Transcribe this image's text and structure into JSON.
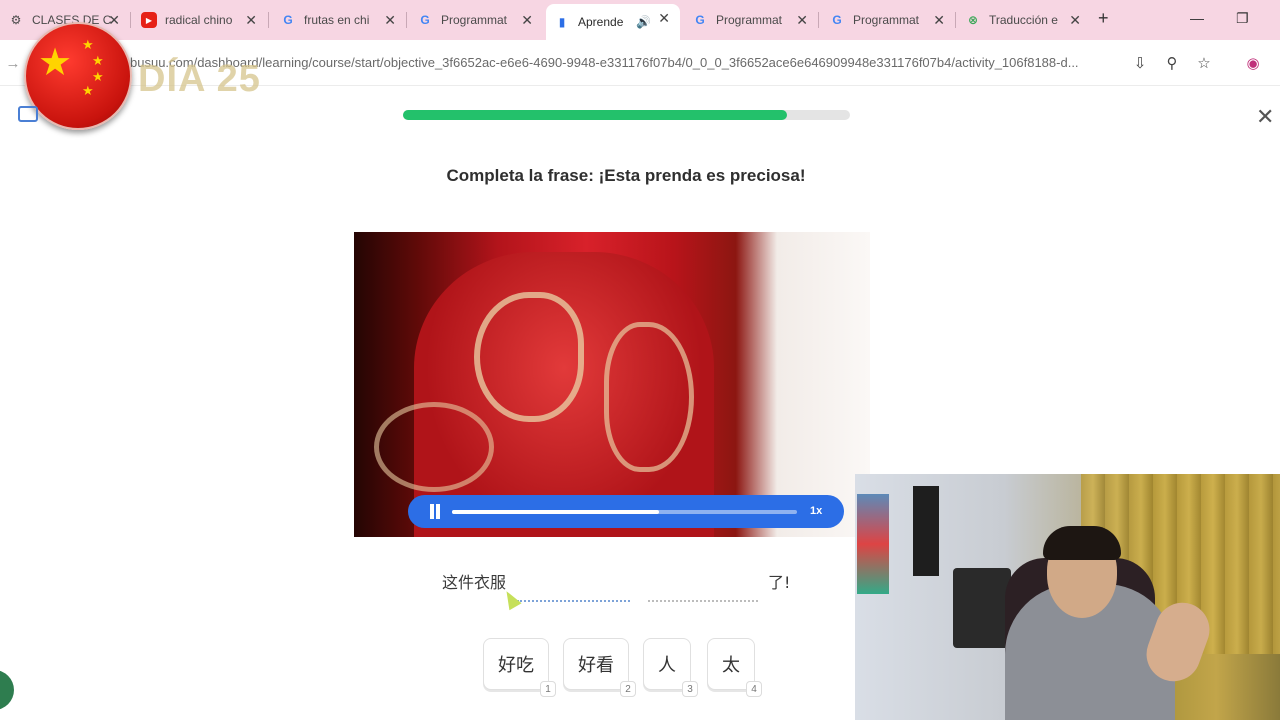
{
  "browser": {
    "tabs": [
      {
        "title": "CLASES DE C",
        "favicon": "chatgpt-icon"
      },
      {
        "title": "radical chino",
        "favicon": "youtube-icon"
      },
      {
        "title": "frutas en chi",
        "favicon": "google-icon"
      },
      {
        "title": "Programmat",
        "favicon": "google-icon"
      },
      {
        "title": "Aprende",
        "favicon": "busuu-icon",
        "active": true,
        "audio": true
      },
      {
        "title": "Programmat",
        "favicon": "google-icon"
      },
      {
        "title": "Programmat",
        "favicon": "google-icon"
      },
      {
        "title": "Traducción e",
        "favicon": "translate-icon"
      }
    ],
    "url": "busuu.com/dashboard/learning/course/start/objective_3f6652ac-e6e6-4690-9948-e331176f07b4/0_0_0_3f6652ace6e646909948e331176f07b4/activity_106f8188-d..."
  },
  "overlay": {
    "day_label": "DÍA 25"
  },
  "lesson": {
    "progress": 0.86,
    "prompt": "Completa la frase: ¡Esta prenda es preciosa!",
    "player": {
      "speed": "1x",
      "position": 0.6
    },
    "sentence": {
      "start": "这件衣服",
      "end": "了!"
    },
    "choices": [
      {
        "text": "好吃",
        "key": "1"
      },
      {
        "text": "好看",
        "key": "2"
      },
      {
        "text": "人",
        "key": "3"
      },
      {
        "text": "太",
        "key": "4"
      }
    ]
  },
  "colors": {
    "tabstrip": "#f7d6e3",
    "progress": "#23c16b",
    "player": "#2c6ee6"
  }
}
